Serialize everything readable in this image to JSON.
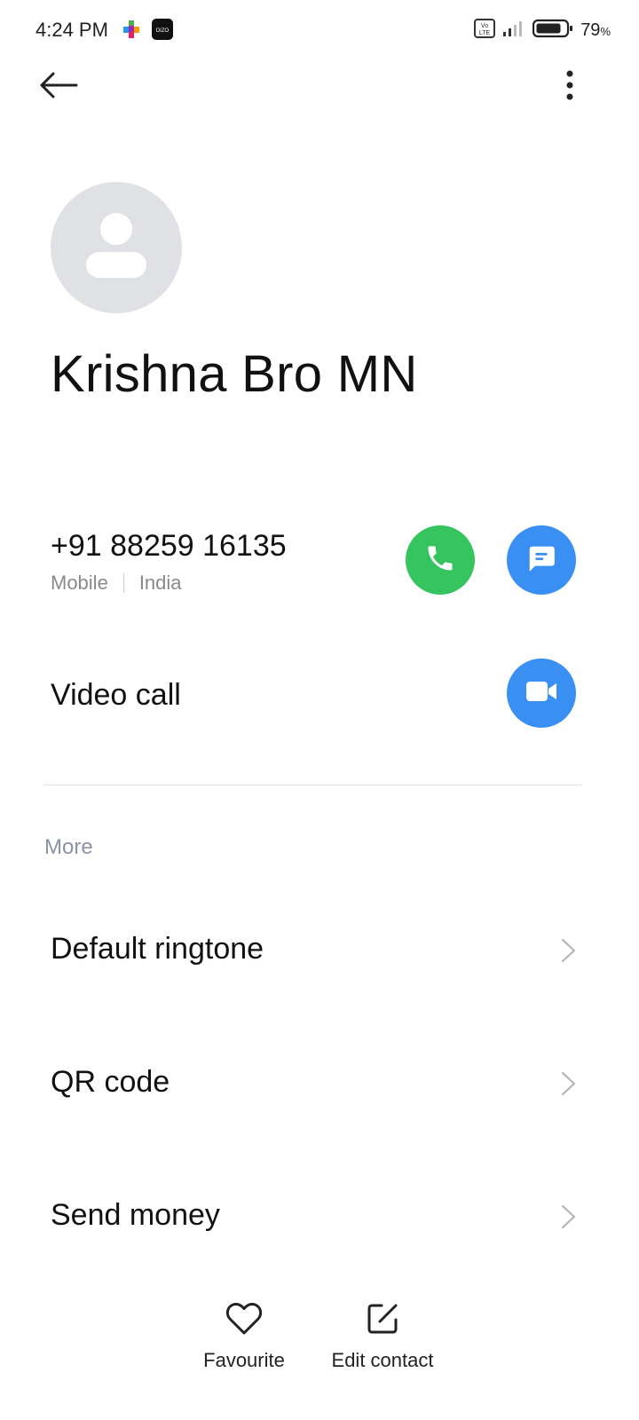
{
  "status_bar": {
    "time": "4:24 PM",
    "app_icons": [
      "colorful-puzzle-icon",
      "dizo-icon"
    ],
    "dizo_icon_text": "DIZO",
    "network_badge": "VoLTE",
    "battery_percent": "79",
    "battery_percent_sign": "%"
  },
  "toolbar": {
    "back_icon": "arrow-left-icon",
    "more_icon": "more-vertical-icon"
  },
  "contact": {
    "name": "Krishna Bro MN",
    "avatar_icon": "person-placeholder-icon",
    "phone": {
      "number": "+91 88259 16135",
      "type": "Mobile",
      "country": "India"
    }
  },
  "actions": {
    "video_call_label": "Video call"
  },
  "more_section": {
    "header": "More",
    "items": [
      {
        "label": "Default ringtone"
      },
      {
        "label": "QR code"
      },
      {
        "label": "Send money"
      }
    ]
  },
  "bottom_bar": {
    "favourite_label": "Favourite",
    "edit_contact_label": "Edit contact"
  },
  "colors": {
    "call_green": "#35c45d",
    "action_blue": "#3a8ff3",
    "avatar_gray": "#dfe1e5",
    "section_header": "#8d93a6"
  }
}
